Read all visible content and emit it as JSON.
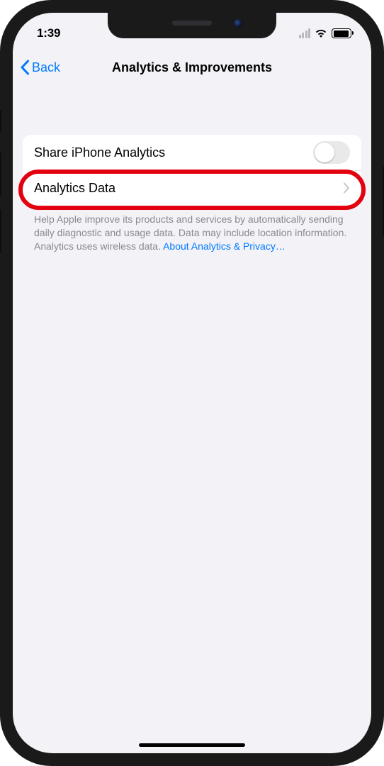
{
  "status": {
    "time": "1:39"
  },
  "navbar": {
    "back_label": "Back",
    "title": "Analytics & Improvements"
  },
  "rows": {
    "share_label": "Share iPhone Analytics",
    "data_label": "Analytics Data"
  },
  "footer": {
    "text": "Help Apple improve its products and services by automatically sending daily diagnostic and usage data. Data may include location information. Analytics uses wireless data. ",
    "link_label": "About Analytics & Privacy…"
  }
}
